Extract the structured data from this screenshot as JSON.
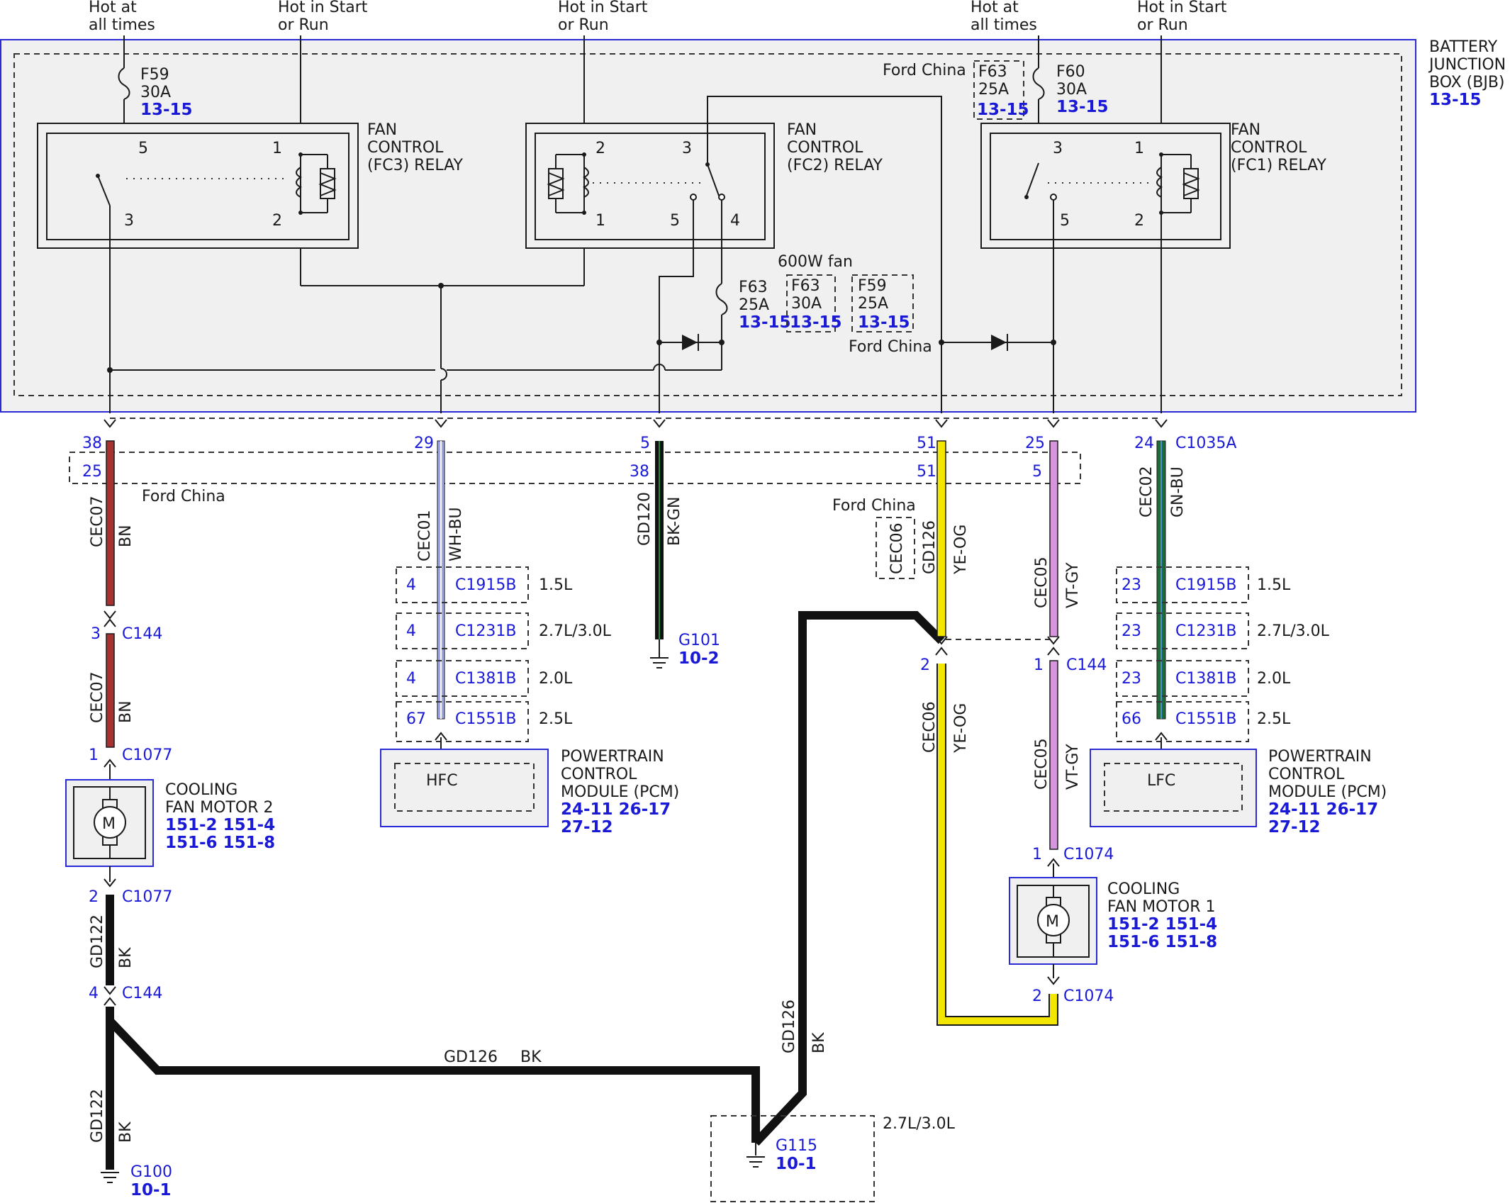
{
  "power_labels": [
    {
      "line1": "Hot at",
      "line2": "all times"
    },
    {
      "line1": "Hot in Start",
      "line2": "or Run"
    },
    {
      "line1": "Hot in Start",
      "line2": "or Run"
    },
    {
      "line1": "Hot at",
      "line2": "all times"
    },
    {
      "line1": "Hot in Start",
      "line2": "or Run"
    }
  ],
  "bjb": {
    "line1": "BATTERY",
    "line2": "JUNCTION",
    "line3": "BOX (BJB)",
    "ref": "13-15"
  },
  "fuses": {
    "f59_top": {
      "name": "F59",
      "rating": "30A",
      "ref": "13-15"
    },
    "f63_china": {
      "name": "F63",
      "rating": "25A",
      "ref": "13-15"
    },
    "f60": {
      "name": "F60",
      "rating": "30A",
      "ref": "13-15"
    },
    "f63_mid": {
      "name": "F63",
      "rating": "25A",
      "ref": "13-15"
    },
    "f63_600w": {
      "name": "F63",
      "rating": "30A",
      "ref": "13-15"
    },
    "f59_mid": {
      "name": "F59",
      "rating": "25A",
      "ref": "13-15"
    }
  },
  "notes": {
    "ford_china": "Ford China",
    "fan_600w": "600W fan",
    "engine_27": "2.7L/3.0L"
  },
  "relays": [
    {
      "line1": "FAN",
      "line2": "CONTROL",
      "line3": "(FC3) RELAY",
      "pins": [
        "5",
        "1",
        "3",
        "2"
      ]
    },
    {
      "line1": "FAN",
      "line2": "CONTROL",
      "line3": "(FC2) RELAY",
      "pins": [
        "2",
        "3",
        "1",
        "5",
        "4"
      ]
    },
    {
      "line1": "FAN",
      "line2": "CONTROL",
      "line3": "(FC1) RELAY",
      "pins": [
        "3",
        "1",
        "5",
        "2"
      ]
    }
  ],
  "pins": {
    "c1035a": "C1035A",
    "top": [
      "38",
      "29",
      "5",
      "51",
      "25",
      "24"
    ],
    "china": [
      "25",
      "38",
      "51",
      "5"
    ]
  },
  "wires": {
    "w1": {
      "circuit": "CEC07",
      "color": "BN"
    },
    "w2": {
      "circuit": "CEC01",
      "color": "WH-BU"
    },
    "w3": {
      "circuit": "GD120",
      "color": "BK-GN"
    },
    "w4": {
      "circuit": "GD126",
      "color": "YE-OG"
    },
    "w4b": {
      "circuit": "CEC06",
      "color": "YE-OG"
    },
    "w5": {
      "circuit": "CEC05",
      "color": "VT-GY"
    },
    "w6": {
      "circuit": "CEC02",
      "color": "GN-BU"
    },
    "w7": {
      "circuit": "GD122",
      "color": "BK"
    },
    "w8": {
      "circuit": "GD126",
      "color": "BK"
    },
    "china_cec06": "CEC06"
  },
  "connectors": {
    "c144_3": {
      "pin": "3",
      "name": "C144"
    },
    "c1077_1": {
      "pin": "1",
      "name": "C1077"
    },
    "c1077_2": {
      "pin": "2",
      "name": "C1077"
    },
    "c144_4": {
      "pin": "4",
      "name": "C144"
    },
    "c144_2": {
      "pin": "2"
    },
    "c144_1": {
      "pin": "1",
      "name": "C144"
    },
    "c1074_1": {
      "pin": "1",
      "name": "C1074"
    },
    "c1074_2": {
      "pin": "2",
      "name": "C1074"
    }
  },
  "pcm_left": {
    "rows": [
      {
        "pin": "4",
        "conn": "C1915B",
        "engine": "1.5L"
      },
      {
        "pin": "4",
        "conn": "C1231B",
        "engine": "2.7L/3.0L"
      },
      {
        "pin": "4",
        "conn": "C1381B",
        "engine": "2.0L"
      },
      {
        "pin": "67",
        "conn": "C1551B",
        "engine": "2.5L"
      }
    ],
    "inner": "HFC",
    "line1": "POWERTRAIN",
    "line2": "CONTROL",
    "line3": "MODULE (PCM)",
    "ref1": "24-11 26-17",
    "ref2": "27-12"
  },
  "pcm_right": {
    "rows": [
      {
        "pin": "23",
        "conn": "C1915B",
        "engine": "1.5L"
      },
      {
        "pin": "23",
        "conn": "C1231B",
        "engine": "2.7L/3.0L"
      },
      {
        "pin": "23",
        "conn": "C1381B",
        "engine": "2.0L"
      },
      {
        "pin": "66",
        "conn": "C1551B",
        "engine": "2.5L"
      }
    ],
    "inner": "LFC",
    "line1": "POWERTRAIN",
    "line2": "CONTROL",
    "line3": "MODULE (PCM)",
    "ref1": "24-11 26-17",
    "ref2": "27-12"
  },
  "motors": {
    "m2": {
      "line1": "COOLING",
      "line2": "FAN MOTOR 2",
      "ref1": "151-2 151-4",
      "ref2": "151-6 151-8",
      "symbol": "M"
    },
    "m1": {
      "line1": "COOLING",
      "line2": "FAN MOTOR 1",
      "ref1": "151-2 151-4",
      "ref2": "151-6 151-8",
      "symbol": "M"
    }
  },
  "grounds": {
    "g101": {
      "name": "G101",
      "ref": "10-2"
    },
    "g100": {
      "name": "G100",
      "ref": "10-1"
    },
    "g115": {
      "name": "G115",
      "ref": "10-1"
    }
  },
  "colors": {
    "BN": "#a83232",
    "WH-BU": "#9fa6e8",
    "BK-GN": "#111111",
    "YE-OG": "#f3e600",
    "VT-GY": "#d596dc",
    "GN-BU": "#1f6b35",
    "BK": "#111111",
    "border_blue": "#2a2ad6"
  },
  "icons": [
    "fuse-icon",
    "relay-coil-icon",
    "relay-switch-icon",
    "diode-icon",
    "motor-icon",
    "ground-icon",
    "connector-arrow-icon"
  ]
}
